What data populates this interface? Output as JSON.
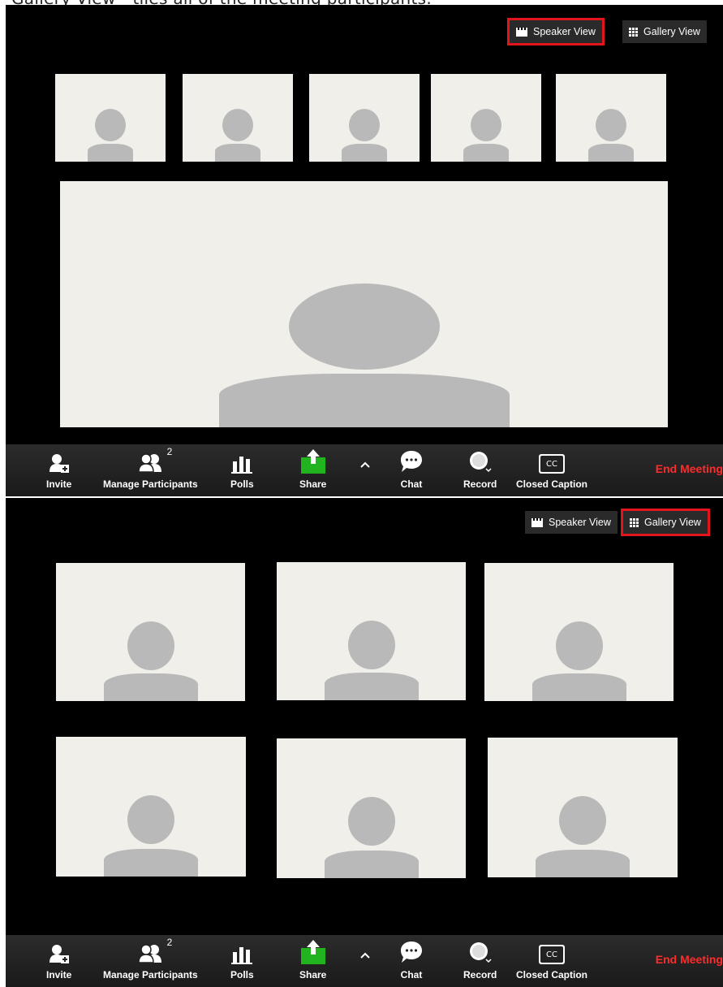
{
  "caption": "Gallery View - tiles all of the meeting participants.",
  "colors": {
    "highlight": "#e1151b",
    "share_green": "#22b41e",
    "end_red": "#ff2b2b",
    "tile_bg": "#f0efe9",
    "avatar": "#b9b9b9"
  },
  "panels": [
    {
      "selected_view": "speaker",
      "view_buttons": {
        "speaker": "Speaker View",
        "gallery": "Gallery View"
      },
      "thumbnail_count": 5,
      "main_tile": "active-speaker"
    },
    {
      "selected_view": "gallery",
      "view_buttons": {
        "speaker": "Speaker View",
        "gallery": "Gallery View"
      },
      "tile_count": 6
    }
  ],
  "toolbar": {
    "invite": "Invite",
    "manage_participants": "Manage Participants",
    "participant_count": "2",
    "polls": "Polls",
    "share": "Share",
    "chat": "Chat",
    "record": "Record",
    "closed_caption": "Closed Caption",
    "cc_badge": "CC",
    "end_meeting": "End Meeting",
    "more_caret": "^",
    "icons": [
      "add-person-icon",
      "participants-icon",
      "polls-icon",
      "share-icon",
      "chevron-up-icon",
      "chat-icon",
      "record-icon",
      "closed-caption-icon"
    ]
  }
}
